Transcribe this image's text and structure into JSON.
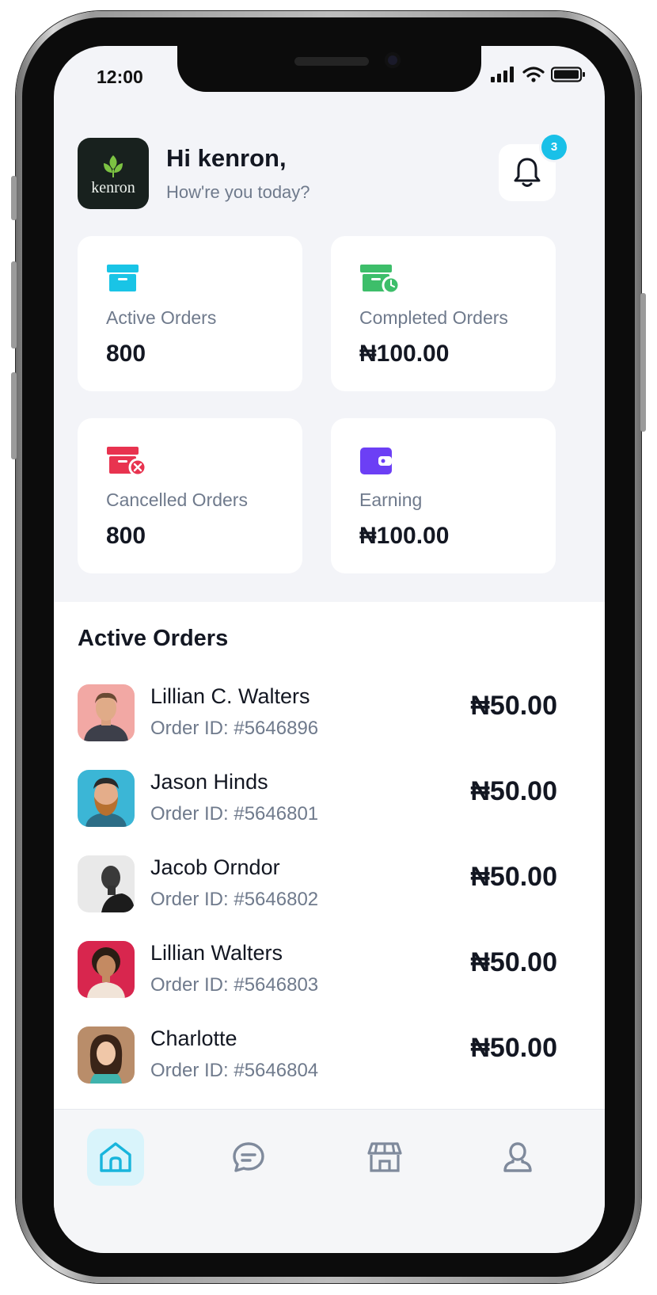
{
  "status_bar": {
    "time": "12:00"
  },
  "header": {
    "logo_text": "kenron",
    "greeting": "Hi kenron,",
    "subtitle": "How're you today?",
    "notification_count": "3"
  },
  "stats": [
    {
      "label": "Active Orders",
      "value": "800",
      "icon": "archive-box-icon",
      "color": "#19c4e6"
    },
    {
      "label": "Completed Orders",
      "value": "₦100.00",
      "icon": "archive-check-icon",
      "color": "#3dbe6a"
    },
    {
      "label": "Cancelled Orders",
      "value": "800",
      "icon": "archive-cancel-icon",
      "color": "#e8334f"
    },
    {
      "label": "Earning",
      "value": "₦100.00",
      "icon": "wallet-icon",
      "color": "#6c3ff5"
    }
  ],
  "active_orders": {
    "title": "Active Orders",
    "items": [
      {
        "name": "Lillian C. Walters",
        "order_id": "Order ID: #5646896",
        "price": "₦50.00"
      },
      {
        "name": "Jason Hinds",
        "order_id": "Order ID: #5646801",
        "price": "₦50.00"
      },
      {
        "name": "Jacob Orndor",
        "order_id": "Order ID: #5646802",
        "price": "₦50.00"
      },
      {
        "name": "Lillian Walters",
        "order_id": "Order ID: #5646803",
        "price": "₦50.00"
      },
      {
        "name": "Charlotte",
        "order_id": "Order ID: #5646804",
        "price": "₦50.00"
      }
    ]
  },
  "tabbar": [
    {
      "icon": "home-icon",
      "active": true
    },
    {
      "icon": "chat-icon",
      "active": false
    },
    {
      "icon": "store-icon",
      "active": false
    },
    {
      "icon": "profile-icon",
      "active": false
    }
  ],
  "colors": {
    "accent": "#19c0e8",
    "background": "#f3f4f8",
    "muted_text": "#6f7a8c"
  }
}
